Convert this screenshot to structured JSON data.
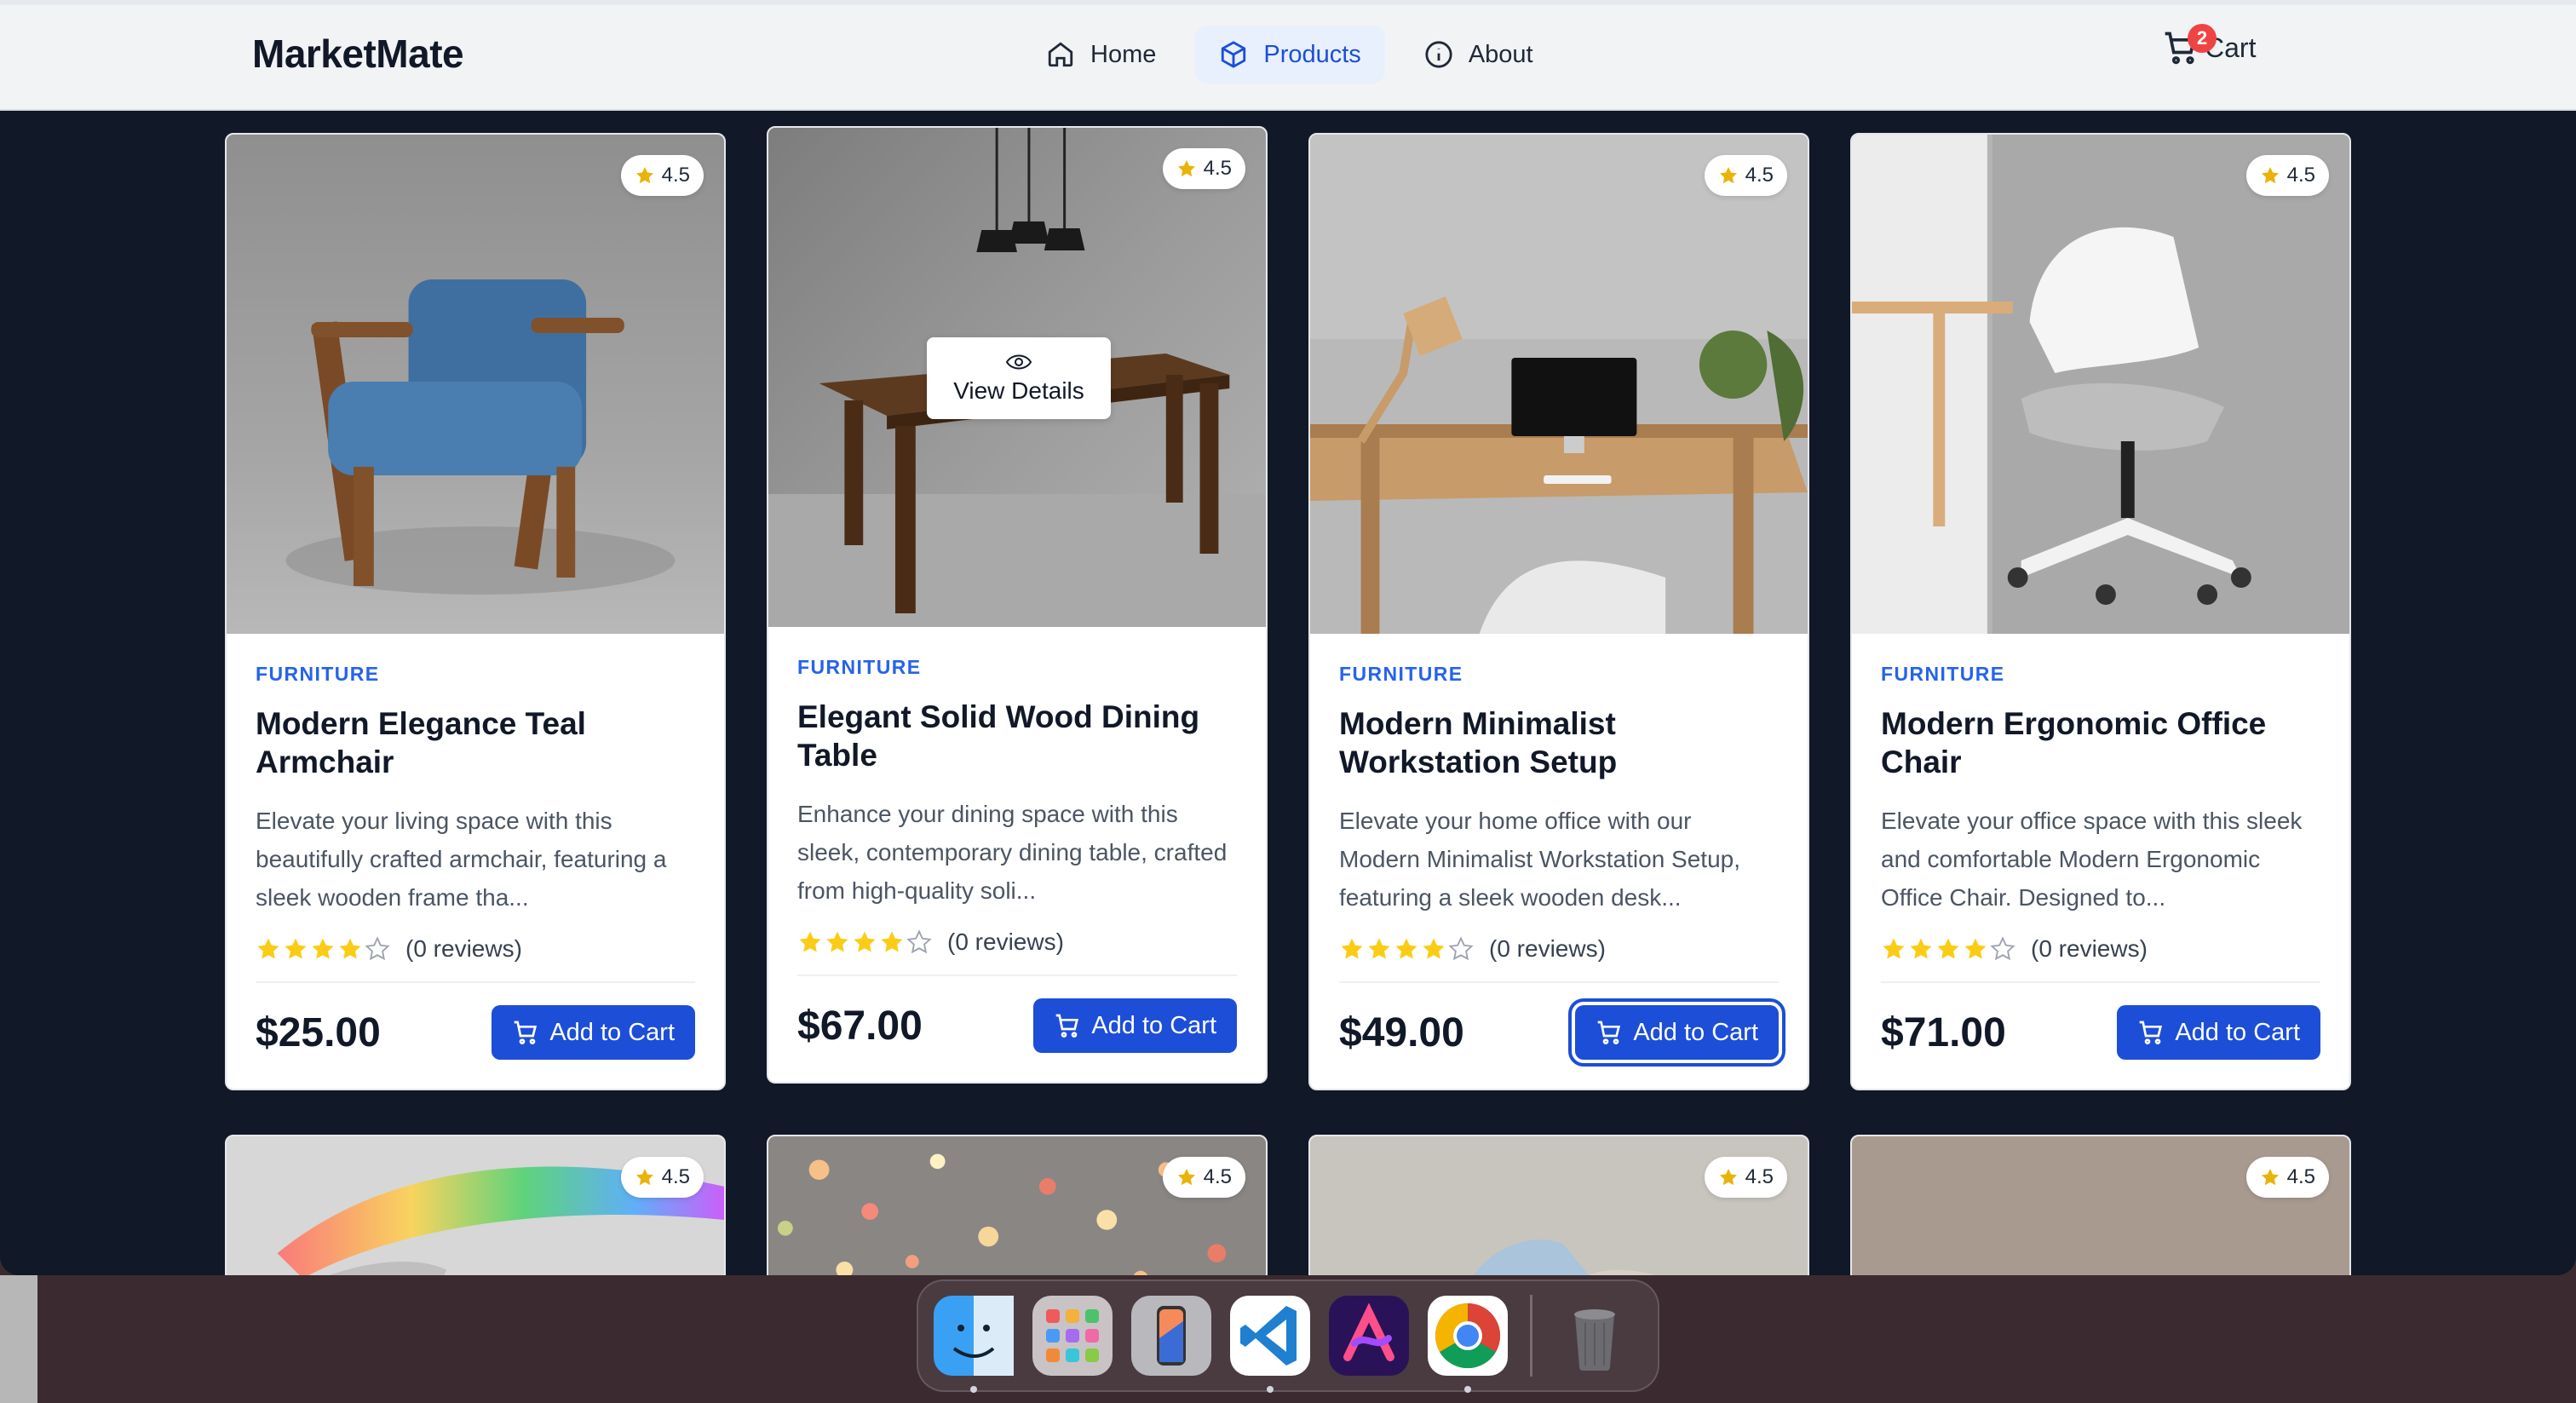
{
  "brand": "MarketMate",
  "nav": [
    {
      "label": "Home",
      "icon": "home-icon"
    },
    {
      "label": "Products",
      "icon": "cube-icon",
      "active": true
    },
    {
      "label": "About",
      "icon": "info-icon"
    }
  ],
  "cart": {
    "label": "Cart",
    "count": "2"
  },
  "products": [
    {
      "category": "FURNITURE",
      "title": "Modern Elegance Teal Armchair",
      "description": "Elevate your living space with this beautifully crafted armchair, featuring a sleek wooden frame tha...",
      "rating": "4.5",
      "stars": 4,
      "reviews": "(0 reviews)",
      "price": "$25.00",
      "button": "Add to Cart"
    },
    {
      "category": "FURNITURE",
      "title": "Elegant Solid Wood Dining Table",
      "description": "Enhance your dining space with this sleek, contemporary dining table, crafted from high-quality soli...",
      "rating": "4.5",
      "stars": 4,
      "reviews": "(0 reviews)",
      "price": "$67.00",
      "button": "Add to Cart",
      "overlay": "View Details"
    },
    {
      "category": "FURNITURE",
      "title": "Modern Minimalist Workstation Setup",
      "description": "Elevate your home office with our Modern Minimalist Workstation Setup, featuring a sleek wooden desk...",
      "rating": "4.5",
      "stars": 4,
      "reviews": "(0 reviews)",
      "price": "$49.00",
      "button": "Add to Cart"
    },
    {
      "category": "FURNITURE",
      "title": "Modern Ergonomic Office Chair",
      "description": "Elevate your office space with this sleek and comfortable Modern Ergonomic Office Chair. Designed to...",
      "rating": "4.5",
      "stars": 4,
      "reviews": "(0 reviews)",
      "price": "$71.00",
      "button": "Add to Cart"
    }
  ],
  "next_row_ratings": [
    "4.5",
    "4.5",
    "4.5",
    "4.5"
  ],
  "dock": [
    "finder-icon",
    "launchpad-icon",
    "iphone-mirroring-icon",
    "vscode-icon",
    "arc-icon",
    "chrome-icon",
    "trash-icon"
  ],
  "colors": {
    "accent": "#1d4ed8",
    "star": "#facc15",
    "badge": "#ef4444",
    "page_bg": "#111827"
  }
}
